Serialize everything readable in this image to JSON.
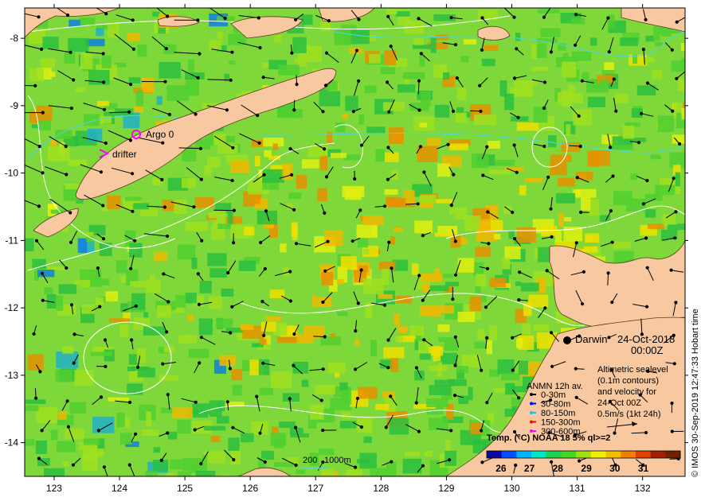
{
  "map": {
    "lon_ticks": [
      "123",
      "124",
      "125",
      "126",
      "127",
      "128",
      "129",
      "130",
      "131",
      "132"
    ],
    "lat_ticks": [
      "-8",
      "-9",
      "-10",
      "-11",
      "-12",
      "-13",
      "-14"
    ]
  },
  "place_labels": {
    "darwin": "Darwin",
    "argo": "Argo 0",
    "drifter": "drifter"
  },
  "date_box": {
    "date": "24-Oct-2018",
    "time": "00:00Z"
  },
  "altimetry_note": [
    "Altimetric sealevel",
    "(0.1m contours)",
    "and velocity for",
    "24-Oct 00Z",
    "0.5m/s (1kt 24h)"
  ],
  "anmn_legend": {
    "title": "ANMN 12h av.",
    "items": [
      {
        "label": "0-30m",
        "color": "#000000"
      },
      {
        "label": "30-80m",
        "color": "#0000ff"
      },
      {
        "label": "80-150m",
        "color": "#00c8ff"
      },
      {
        "label": "150-300m",
        "color": "#ff0000"
      },
      {
        "label": "300-600m",
        "color": "#ff00ff"
      }
    ]
  },
  "colorbar": {
    "title": "Temp. (°C) NOAA 18 5% ql>=2",
    "ticks": [
      "26",
      "27",
      "28",
      "29",
      "30",
      "31"
    ],
    "colors": [
      "#0a0aa0",
      "#0050ff",
      "#00b4ff",
      "#00e6c8",
      "#20d050",
      "#40d820",
      "#a0e010",
      "#f0f000",
      "#f0c000",
      "#f08000",
      "#e04000",
      "#a02000",
      "#702000"
    ]
  },
  "scale_bar": {
    "left": "200",
    "right": "1000m"
  },
  "footer": "© IMOS 30-Sep-2019 12:47:33 Hobart time",
  "colors": {
    "land": "#f8c8a0",
    "sea_base": "#7fd83a",
    "contour": "#ffffff",
    "shallow_contour": "#48d8e0"
  }
}
